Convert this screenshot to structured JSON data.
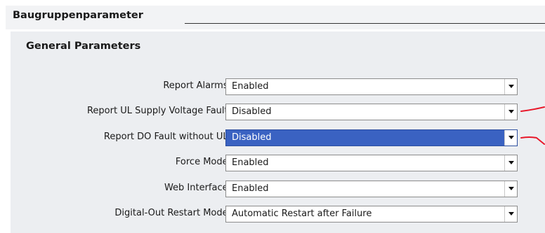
{
  "section": {
    "title": "Baugruppenparameter"
  },
  "group": {
    "title": "General Parameters"
  },
  "parameters": [
    {
      "label": "Report Alarms:",
      "value": "Enabled"
    },
    {
      "label": "Report UL Supply Voltage Fault:",
      "value": "Disabled"
    },
    {
      "label": "Report DO Fault without UL:",
      "value": "Disabled"
    },
    {
      "label": "Force Mode:",
      "value": "Enabled"
    },
    {
      "label": "Web Interface:",
      "value": "Enabled"
    },
    {
      "label": "Digital-Out Restart Mode:",
      "value": "Automatic Restart after Failure"
    }
  ],
  "colors": {
    "selection": "#3a62c2",
    "annotation": "#e8182a",
    "header_bg": "#f2f3f5",
    "group_bg": "#eceef1"
  },
  "icons": {
    "dropdown": "chevron-down-icon",
    "annotation": "red-pen-mark"
  }
}
